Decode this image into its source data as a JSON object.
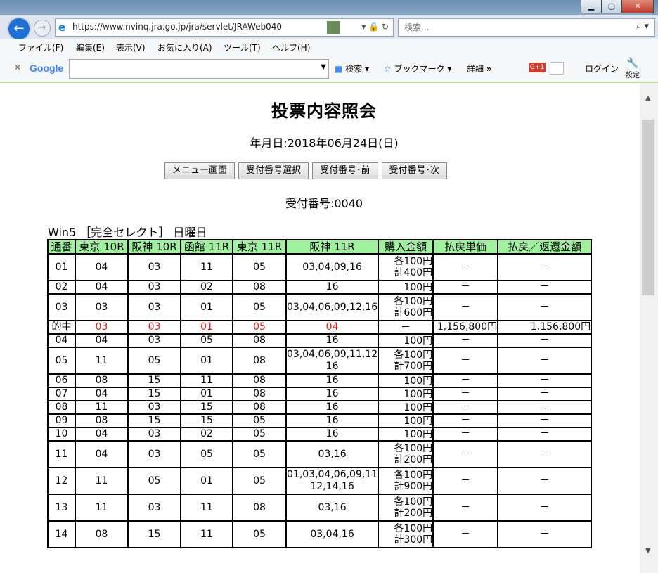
{
  "browser": {
    "url": "https://www.nvinq.jra.go.jp/jra/servlet/JRAWeb040",
    "search_placeholder": "検索...",
    "menu": [
      "ファイル(F)",
      "編集(E)",
      "表示(V)",
      "お気に入り(A)",
      "ツール(T)",
      "ヘルプ(H)"
    ],
    "google": {
      "logo": "Google",
      "search": "検索",
      "bookmarks": "ブックマーク",
      "details": "詳細",
      "more": "»",
      "gplus": "G+1",
      "login": "ログイン",
      "settings": "設定"
    }
  },
  "page": {
    "title": "投票内容照会",
    "date": "年月日:2018年06月24日(日)",
    "buttons": [
      "メニュー画面",
      "受付番号選択",
      "受付番号･前",
      "受付番号･次"
    ],
    "receipt": "受付番号:0040",
    "subtitle": "Win5 ［完全セレクト］ 日曜日"
  },
  "table": {
    "headers": [
      "通番",
      "東京 10R",
      "阪神 10R",
      "函館 11R",
      "東京 11R",
      "阪神 11R",
      "購入金額",
      "払戻単価",
      "払戻／返還金額"
    ],
    "rows": [
      {
        "no": "01",
        "r1": "04",
        "r2": "03",
        "r3": "11",
        "r4": "05",
        "r5": "03,04,09,16",
        "amt1": "各100円",
        "amt2": "計400円",
        "pay": "－",
        "ret": "－"
      },
      {
        "no": "02",
        "r1": "04",
        "r2": "03",
        "r3": "02",
        "r4": "08",
        "r5": "16",
        "amt1": "100円",
        "amt2": "",
        "pay": "－",
        "ret": "－"
      },
      {
        "no": "03",
        "r1": "03",
        "r2": "03",
        "r3": "01",
        "r4": "05",
        "r5": "03,04,06,09,12,16",
        "amt1": "各100円",
        "amt2": "計600円",
        "pay": "－",
        "ret": "－"
      },
      {
        "no": "的中",
        "r1": "03",
        "r2": "03",
        "r3": "01",
        "r4": "05",
        "r5": "04",
        "amt1": "－",
        "amt2": "",
        "pay": "1,156,800円",
        "ret": "1,156,800円",
        "hit": true
      },
      {
        "no": "04",
        "r1": "04",
        "r2": "03",
        "r3": "05",
        "r4": "08",
        "r5": "16",
        "amt1": "100円",
        "amt2": "",
        "pay": "－",
        "ret": "－"
      },
      {
        "no": "05",
        "r1": "11",
        "r2": "05",
        "r3": "01",
        "r4": "08",
        "r5": "03,04,06,09,11,12",
        "r5b": "16",
        "amt1": "各100円",
        "amt2": "計700円",
        "pay": "－",
        "ret": "－"
      },
      {
        "no": "06",
        "r1": "08",
        "r2": "15",
        "r3": "11",
        "r4": "08",
        "r5": "16",
        "amt1": "100円",
        "amt2": "",
        "pay": "－",
        "ret": "－"
      },
      {
        "no": "07",
        "r1": "04",
        "r2": "15",
        "r3": "01",
        "r4": "08",
        "r5": "16",
        "amt1": "100円",
        "amt2": "",
        "pay": "－",
        "ret": "－"
      },
      {
        "no": "08",
        "r1": "11",
        "r2": "03",
        "r3": "15",
        "r4": "08",
        "r5": "16",
        "amt1": "100円",
        "amt2": "",
        "pay": "－",
        "ret": "－"
      },
      {
        "no": "09",
        "r1": "08",
        "r2": "15",
        "r3": "15",
        "r4": "05",
        "r5": "16",
        "amt1": "100円",
        "amt2": "",
        "pay": "－",
        "ret": "－"
      },
      {
        "no": "10",
        "r1": "04",
        "r2": "03",
        "r3": "02",
        "r4": "05",
        "r5": "16",
        "amt1": "100円",
        "amt2": "",
        "pay": "－",
        "ret": "－"
      },
      {
        "no": "11",
        "r1": "04",
        "r2": "03",
        "r3": "05",
        "r4": "05",
        "r5": "03,16",
        "amt1": "各100円",
        "amt2": "計200円",
        "pay": "－",
        "ret": "－"
      },
      {
        "no": "12",
        "r1": "11",
        "r2": "05",
        "r3": "01",
        "r4": "05",
        "r5": "01,03,04,06,09,11",
        "r5b": "12,14,16",
        "amt1": "各100円",
        "amt2": "計900円",
        "pay": "－",
        "ret": "－"
      },
      {
        "no": "13",
        "r1": "11",
        "r2": "03",
        "r3": "11",
        "r4": "08",
        "r5": "03,16",
        "amt1": "各100円",
        "amt2": "計200円",
        "pay": "－",
        "ret": "－"
      },
      {
        "no": "14",
        "r1": "08",
        "r2": "15",
        "r3": "11",
        "r4": "05",
        "r5": "03,04,16",
        "amt1": "各100円",
        "amt2": "計300円",
        "pay": "－",
        "ret": "－"
      }
    ]
  }
}
